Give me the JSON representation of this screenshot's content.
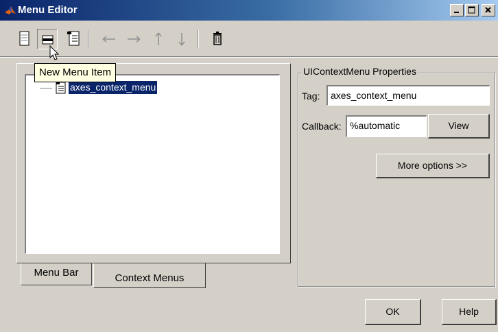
{
  "window": {
    "title": "Menu Editor",
    "controls": [
      "minimize-icon",
      "maximize-icon",
      "close-icon"
    ]
  },
  "toolbar": {
    "buttons": [
      {
        "icon": "new-menu-icon"
      },
      {
        "icon": "new-menu-item-icon",
        "pressed": true
      },
      {
        "icon": "new-context-menu-icon"
      },
      {
        "icon": "arrow-left-icon"
      },
      {
        "icon": "arrow-right-icon"
      },
      {
        "icon": "arrow-up-icon"
      },
      {
        "icon": "arrow-down-icon"
      },
      {
        "icon": "delete-icon"
      }
    ],
    "tooltip": "New Menu Item"
  },
  "tree": {
    "items": [
      {
        "label": "axes_context_menu",
        "selected": true
      }
    ]
  },
  "tabs": [
    {
      "label": "Menu Bar",
      "active": false
    },
    {
      "label": "Context Menus",
      "active": true
    }
  ],
  "properties": {
    "group_title": "UIContextMenu Properties",
    "tag_label": "Tag:",
    "tag_value": "axes_context_menu",
    "callback_label": "Callback:",
    "callback_value": "%automatic",
    "view_button": "View",
    "more_options_button": "More options >>"
  },
  "footer": {
    "ok_button": "OK",
    "help_button": "Help"
  },
  "colors": {
    "titlebar_start": "#0a246a",
    "titlebar_end": "#a6caf0",
    "selection": "#0a246a",
    "tooltip_bg": "#ffffe1",
    "face": "#d4d0c8"
  }
}
